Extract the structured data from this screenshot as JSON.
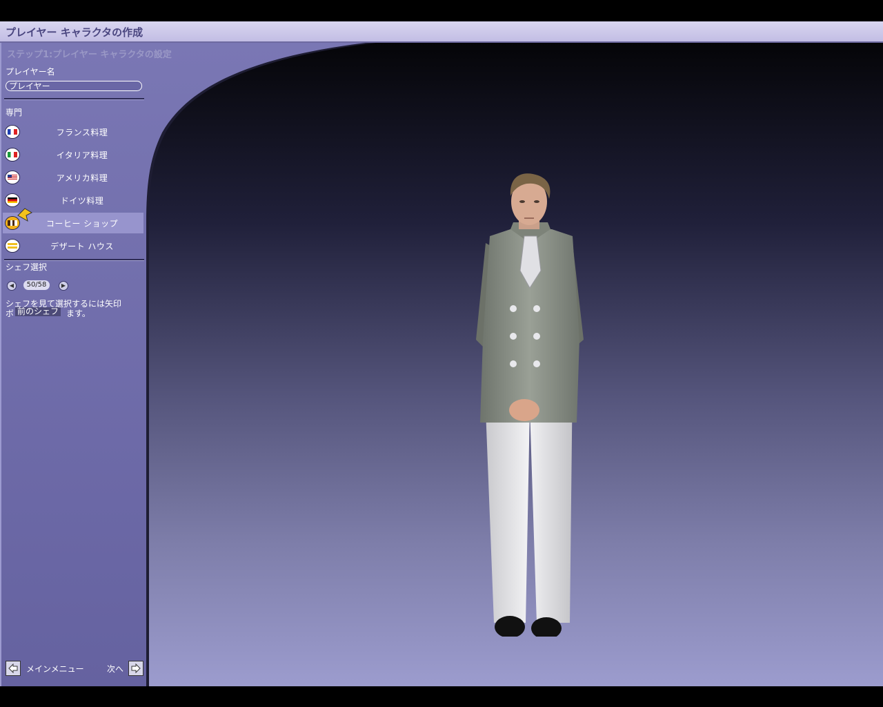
{
  "window": {
    "title": "プレイヤー キャラクタの作成"
  },
  "panel": {
    "step_title": "ステップ1:プレイヤー キャラクタの設定",
    "player_name_label": "プレイヤー名",
    "player_name_value": "プレイヤー",
    "specialty_label": "専門",
    "specialties": [
      {
        "label": "フランス料理",
        "icon": "france-flag-icon",
        "selected": false
      },
      {
        "label": "イタリア料理",
        "icon": "italy-flag-icon",
        "selected": false
      },
      {
        "label": "アメリカ料理",
        "icon": "usa-flag-icon",
        "selected": false
      },
      {
        "label": "ドイツ料理",
        "icon": "germany-flag-icon",
        "selected": false
      },
      {
        "label": "コーヒー ショップ",
        "icon": "coffee-shop-icon",
        "selected": true
      },
      {
        "label": "デザート ハウス",
        "icon": "dessert-house-icon",
        "selected": false
      }
    ],
    "chef_select_label": "シェフ選択",
    "chef_counter": "50/58",
    "help_line1": "シェフを見て選択するには矢印",
    "help_line2": "ボ",
    "help_line2_end": "ます。",
    "tooltip": "前のシェフ"
  },
  "footer": {
    "back_label": "メインメニュー",
    "next_label": "次へ"
  },
  "colors": {
    "panel": "#6d6aa8",
    "selected_row": "#9794cd",
    "title_bar": "#ccc8ea"
  }
}
